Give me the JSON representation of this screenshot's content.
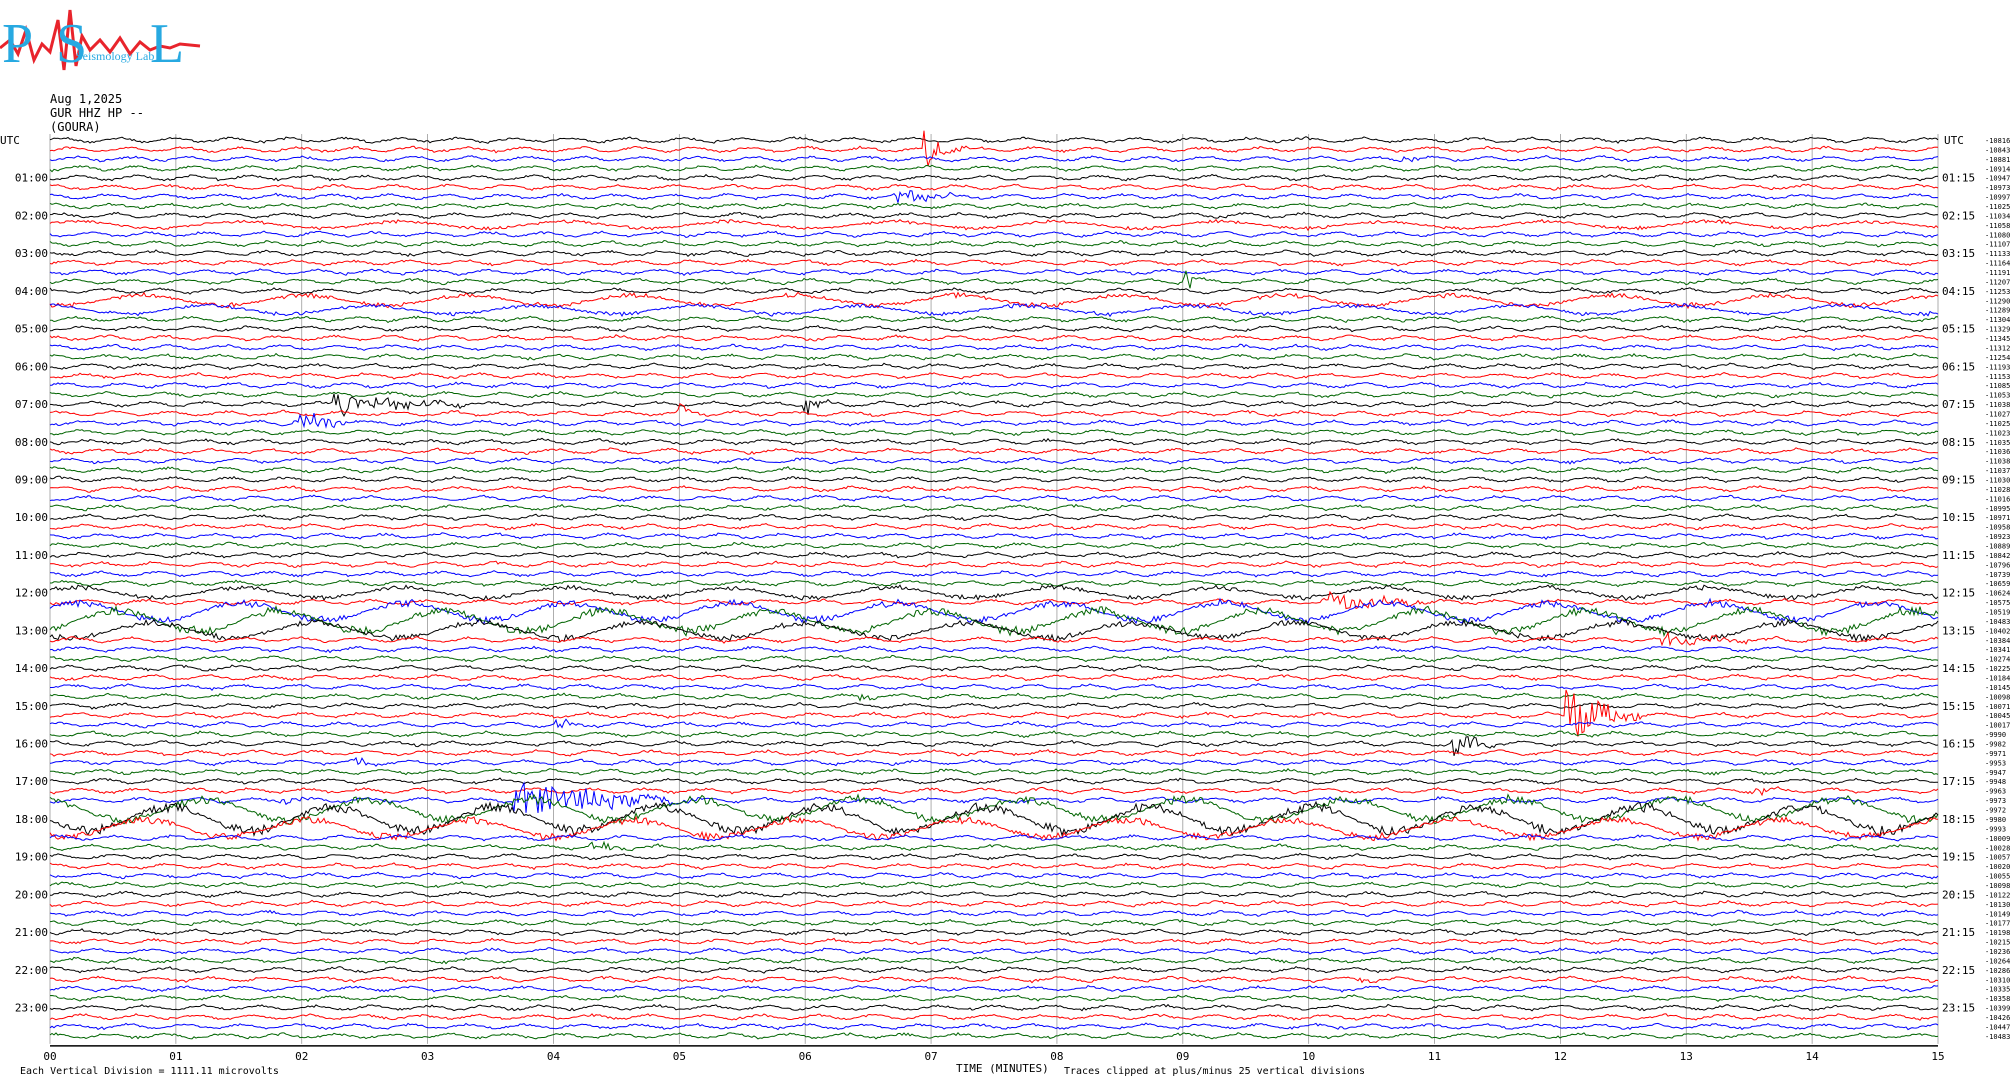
{
  "logo": {
    "letters": "PSL",
    "text": "Seismology Lab",
    "colors": {
      "letters": "#27a9e1",
      "wave": "#e8242c"
    }
  },
  "header": {
    "date": "Aug 1,2025",
    "station": "GUR HHZ HP --",
    "site": "(GOURA)"
  },
  "footer": {
    "scale_note": "Each Vertical Division = 1111.11 microvolts",
    "clip_note": "Traces clipped at plus/minus 25 vertical divisions"
  },
  "chart_data": {
    "type": "line",
    "xlabel": "TIME (MINUTES)",
    "xlim": [
      0,
      15
    ],
    "x_ticks": [
      "00",
      "01",
      "02",
      "03",
      "04",
      "05",
      "06",
      "07",
      "08",
      "09",
      "10",
      "11",
      "12",
      "13",
      "14",
      "15"
    ],
    "left_axis_title": "UTC",
    "right_axis_title": "UTC",
    "hour_labels_left": [
      "01:00",
      "02:00",
      "03:00",
      "04:00",
      "05:00",
      "06:00",
      "07:00",
      "08:00",
      "09:00",
      "10:00",
      "11:00",
      "12:00",
      "13:00",
      "14:00",
      "15:00",
      "16:00",
      "17:00",
      "18:00",
      "19:00",
      "20:00",
      "21:00",
      "22:00",
      "23:00"
    ],
    "hour_labels_right": [
      "01:15",
      "02:15",
      "03:15",
      "04:15",
      "05:15",
      "06:15",
      "07:15",
      "08:15",
      "09:15",
      "10:15",
      "11:15",
      "12:15",
      "13:15",
      "14:15",
      "15:15",
      "16:15",
      "17:15",
      "18:15",
      "19:15",
      "20:15",
      "21:15",
      "22:15",
      "23:15"
    ],
    "traces_per_hour": 4,
    "trace_count": 96,
    "trace_colors": [
      "#000000",
      "#ff0000",
      "#0000ff",
      "#006400"
    ],
    "trace_offsets": [
      "-10816",
      "-10843",
      "-10881",
      "-10914",
      "-10947",
      "-10973",
      "-10997",
      "-11025",
      "-11034",
      "-11058",
      "-11080",
      "-11107",
      "-11133",
      "-11164",
      "-11191",
      "-11207",
      "-11253",
      "-11290",
      "-11289",
      "-11304",
      "-11329",
      "-11345",
      "-11312",
      "-11254",
      "-11193",
      "-11153",
      "-11085",
      "-11053",
      "-11038",
      "-11027",
      "-11025",
      "-11023",
      "-11035",
      "-11036",
      "-11038",
      "-11037",
      "-11030",
      "-11028",
      "-11016",
      "-10995",
      "-10971",
      "-10958",
      "-10923",
      "-10889",
      "-10842",
      "-10796",
      "-10739",
      "-10659",
      "-10624",
      "-10575",
      "-10519",
      "-10483",
      "-10402",
      "-10384",
      "-10341",
      "-10274",
      "-10225",
      "-10184",
      "-10145",
      "-10098",
      "-10071",
      "-10045",
      "-10017",
      "-9990",
      "-9982",
      "-9971",
      "-9953",
      "-9947",
      "-9948",
      "-9963",
      "-9973",
      "-9972",
      "-9980",
      "-9993",
      "-10009",
      "-10028",
      "-10057",
      "-10020",
      "-10055",
      "-10098",
      "-10122",
      "-10130",
      "-10149",
      "-10177",
      "-10198",
      "-10215",
      "-10236",
      "-10264",
      "-10286",
      "-10310",
      "-10335",
      "-10358",
      "-10399",
      "-10426",
      "-10447",
      "-10483"
    ],
    "events": [
      {
        "trace": 1,
        "minute": 6.95,
        "amplitude": 20,
        "duration": 0.35
      },
      {
        "trace": 2,
        "minute": 10.75,
        "amplitude": 5,
        "duration": 0.2
      },
      {
        "trace": 6,
        "minute": 6.75,
        "amplitude": 9,
        "duration": 0.5
      },
      {
        "trace": 15,
        "minute": 9.02,
        "amplitude": 16,
        "duration": 0.15
      },
      {
        "trace": 28,
        "minute": 2.25,
        "amplitude": 12,
        "duration": 1.2
      },
      {
        "trace": 28,
        "minute": 6.0,
        "amplitude": 14,
        "duration": 0.2
      },
      {
        "trace": 29,
        "minute": 5.0,
        "amplitude": 10,
        "duration": 0.2
      },
      {
        "trace": 30,
        "minute": 1.95,
        "amplitude": 14,
        "duration": 0.6
      },
      {
        "trace": 49,
        "minute": 10.1,
        "amplitude": 10,
        "duration": 1.2
      },
      {
        "trace": 53,
        "minute": 12.8,
        "amplitude": 7,
        "duration": 1.0
      },
      {
        "trace": 59,
        "minute": 6.45,
        "amplitude": 5,
        "duration": 0.2
      },
      {
        "trace": 61,
        "minute": 12.05,
        "amplitude": 30,
        "duration": 0.6
      },
      {
        "trace": 62,
        "minute": 4.03,
        "amplitude": 12,
        "duration": 0.15
      },
      {
        "trace": 64,
        "minute": 11.15,
        "amplitude": 15,
        "duration": 0.35
      },
      {
        "trace": 66,
        "minute": 2.45,
        "amplitude": 6,
        "duration": 0.3
      },
      {
        "trace": 69,
        "minute": 13.55,
        "amplitude": 7,
        "duration": 0.2
      },
      {
        "trace": 70,
        "minute": 1.85,
        "amplitude": 5,
        "duration": 0.3
      },
      {
        "trace": 70,
        "minute": 3.7,
        "amplitude": 22,
        "duration": 1.5
      },
      {
        "trace": 75,
        "minute": 4.3,
        "amplitude": 5,
        "duration": 0.6
      },
      {
        "trace": 89,
        "minute": 10.4,
        "amplitude": 5,
        "duration": 0.3
      }
    ],
    "noisy_traces": [
      {
        "trace": 48,
        "amplitude": 6
      },
      {
        "trace": 50,
        "amplitude": 10
      },
      {
        "trace": 51,
        "amplitude": 12
      },
      {
        "trace": 52,
        "amplitude": 9
      },
      {
        "trace": 71,
        "amplitude": 12
      },
      {
        "trace": 72,
        "amplitude": 14
      },
      {
        "trace": 73,
        "amplitude": 10
      },
      {
        "trace": 17,
        "amplitude": 6
      },
      {
        "trace": 18,
        "amplitude": 5
      },
      {
        "trace": 9,
        "amplitude": 4
      }
    ]
  }
}
